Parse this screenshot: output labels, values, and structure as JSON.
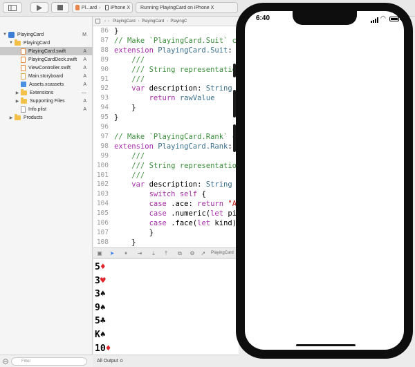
{
  "toolbar": {
    "scheme_name": "Pl...ard",
    "device_name": "iPhone X",
    "status_text": "Running PlayingCard on iPhone X"
  },
  "navigator": {
    "items": [
      {
        "label": "PlayingCard",
        "status": "M",
        "kind": "project",
        "level": 0,
        "expanded": true
      },
      {
        "label": "PlayingCard",
        "status": "",
        "kind": "folder",
        "level": 1,
        "expanded": true
      },
      {
        "label": "PlayingCard.swift",
        "status": "A",
        "kind": "swift",
        "level": 2,
        "selected": true
      },
      {
        "label": "PlayingCardDeck.swift",
        "status": "A",
        "kind": "swift",
        "level": 2
      },
      {
        "label": "ViewController.swift",
        "status": "A",
        "kind": "swift",
        "level": 2
      },
      {
        "label": "Main.storyboard",
        "status": "A",
        "kind": "storyboard",
        "level": 2
      },
      {
        "label": "Assets.xcassets",
        "status": "A",
        "kind": "assets",
        "level": 2
      },
      {
        "label": "Extensions",
        "status": "—",
        "kind": "folder",
        "level": 2,
        "expanded": false
      },
      {
        "label": "Supporting Files",
        "status": "A",
        "kind": "folder",
        "level": 2,
        "expanded": false
      },
      {
        "label": "Info.plist",
        "status": "A",
        "kind": "plist",
        "level": 2
      },
      {
        "label": "Products",
        "status": "",
        "kind": "folder",
        "level": 1,
        "expanded": false
      }
    ],
    "filter_placeholder": "Filter"
  },
  "jumpbar": {
    "crumbs": [
      "PlayingCard",
      "PlayingCard",
      "PlayingC"
    ]
  },
  "editor": {
    "lines": [
      {
        "n": "86",
        "tokens": [
          [
            "plain",
            "}"
          ]
        ]
      },
      {
        "n": "87",
        "tokens": [
          [
            "cm",
            "// Make `PlayingCard.Suit` c"
          ]
        ]
      },
      {
        "n": "88",
        "tokens": [
          [
            "kw",
            "extension "
          ],
          [
            "ty",
            "PlayingCard.Suit"
          ],
          [
            "plain",
            ":"
          ]
        ]
      },
      {
        "n": "89",
        "tokens": [
          [
            "cm",
            "    ///"
          ]
        ]
      },
      {
        "n": "90",
        "tokens": [
          [
            "cm",
            "    /// String representatio"
          ]
        ]
      },
      {
        "n": "91",
        "tokens": [
          [
            "cm",
            "    ///"
          ]
        ]
      },
      {
        "n": "92",
        "tokens": [
          [
            "kw",
            "    var "
          ],
          [
            "plain",
            "description: "
          ],
          [
            "ty",
            "String"
          ]
        ]
      },
      {
        "n": "93",
        "tokens": [
          [
            "kw",
            "        return "
          ],
          [
            "ty",
            "rawValue"
          ]
        ]
      },
      {
        "n": "94",
        "tokens": [
          [
            "plain",
            "    }"
          ]
        ]
      },
      {
        "n": "95",
        "tokens": [
          [
            "plain",
            "}"
          ]
        ]
      },
      {
        "n": "96",
        "tokens": [
          [
            "plain",
            ""
          ]
        ]
      },
      {
        "n": "97",
        "tokens": [
          [
            "cm",
            "// Make `PlayingCard.Rank` c"
          ]
        ]
      },
      {
        "n": "98",
        "tokens": [
          [
            "kw",
            "extension "
          ],
          [
            "ty",
            "PlayingCard.Rank"
          ],
          [
            "plain",
            ":"
          ]
        ]
      },
      {
        "n": "99",
        "tokens": [
          [
            "cm",
            "    ///"
          ]
        ]
      },
      {
        "n": "100",
        "tokens": [
          [
            "cm",
            "    /// String representatio"
          ]
        ]
      },
      {
        "n": "101",
        "tokens": [
          [
            "cm",
            "    ///"
          ]
        ]
      },
      {
        "n": "102",
        "tokens": [
          [
            "kw",
            "    var "
          ],
          [
            "plain",
            "description: "
          ],
          [
            "ty",
            "String"
          ]
        ]
      },
      {
        "n": "103",
        "tokens": [
          [
            "kw",
            "        switch self "
          ],
          [
            "plain",
            "{"
          ]
        ]
      },
      {
        "n": "104",
        "tokens": [
          [
            "kw",
            "        case "
          ],
          [
            "plain",
            ".ace: "
          ],
          [
            "kw",
            "return "
          ],
          [
            "str",
            "\"A"
          ]
        ]
      },
      {
        "n": "105",
        "tokens": [
          [
            "kw",
            "        case "
          ],
          [
            "plain",
            ".numeric("
          ],
          [
            "kw",
            "let "
          ],
          [
            "plain",
            "pi"
          ]
        ]
      },
      {
        "n": "106",
        "tokens": [
          [
            "kw",
            "        case "
          ],
          [
            "plain",
            ".face("
          ],
          [
            "kw",
            "let "
          ],
          [
            "plain",
            "kind)"
          ]
        ]
      },
      {
        "n": "107",
        "tokens": [
          [
            "plain",
            "        }"
          ]
        ]
      },
      {
        "n": "108",
        "tokens": [
          [
            "plain",
            "    }"
          ]
        ]
      }
    ]
  },
  "debugbar": {
    "breadcrumb": "PlayingCard"
  },
  "console": {
    "output": [
      {
        "rank": "5",
        "suit": "♦",
        "color": "red"
      },
      {
        "rank": "3",
        "suit": "♥",
        "color": "red"
      },
      {
        "rank": "3",
        "suit": "♠",
        "color": "black"
      },
      {
        "rank": "9",
        "suit": "♠",
        "color": "black"
      },
      {
        "rank": "5",
        "suit": "♣",
        "color": "black"
      },
      {
        "rank": "K",
        "suit": "♠",
        "color": "black"
      },
      {
        "rank": "10",
        "suit": "♦",
        "color": "red"
      }
    ],
    "output_selector": "All Output ≎"
  },
  "simulator": {
    "time": "6:40"
  },
  "colors": {
    "red_suit": "#e0242b",
    "keyword": "#a72daa",
    "comment": "#3d8f3d",
    "type": "#3b6f8c"
  }
}
